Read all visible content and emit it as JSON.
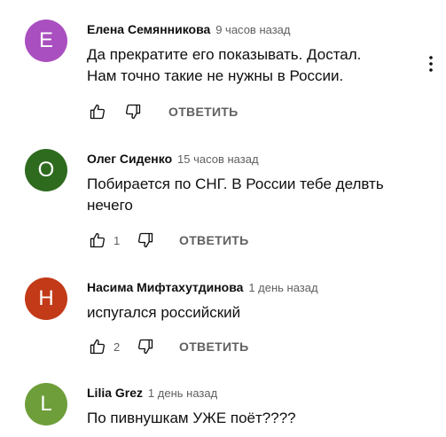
{
  "comments": [
    {
      "author": "Елена Семянникова",
      "time": "9 часов назад",
      "text": "Да прекратите его показывать. Достал.\nНам точно такие не нужны в России.",
      "avatar_letter": "E",
      "avatar_color": "#a94fbf",
      "likes": "",
      "reply_label": "ОТВЕТИТЬ"
    },
    {
      "author": "Олег Сиденко",
      "time": "15 часов назад",
      "text": "Побирается по СНГ. В России тебе делвть\nнечего",
      "avatar_letter": "O",
      "avatar_color": "#2e6b1e",
      "likes": "1",
      "reply_label": "ОТВЕТИТЬ"
    },
    {
      "author": "Насима Мифтахутдинова",
      "time": "1 день назад",
      "text": "испугался российский",
      "avatar_letter": "H",
      "avatar_color": "#c23a17",
      "likes": "2",
      "reply_label": "ОТВЕТИТЬ"
    },
    {
      "author": "Lilia Grez",
      "time": "1 день назад",
      "text": "По пивнушкам УЖЕ поёт????",
      "avatar_letter": "L",
      "avatar_color": "#6e9e3a",
      "likes": "",
      "reply_label": ""
    }
  ],
  "icons": {
    "like": "thumb-up-icon",
    "dislike": "thumb-down-icon",
    "menu": "more-vert-icon"
  }
}
